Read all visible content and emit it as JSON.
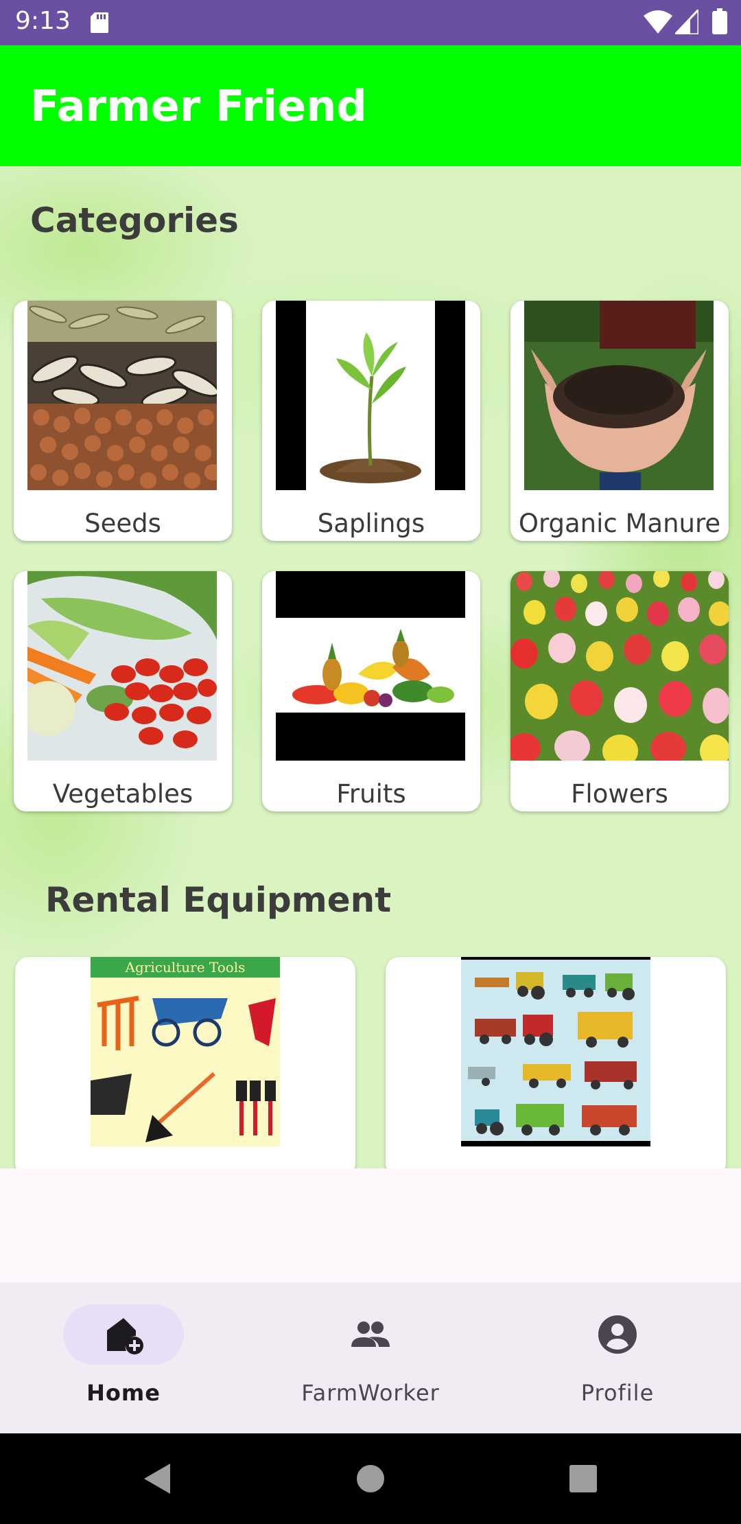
{
  "status_bar": {
    "time": "9:13"
  },
  "app_bar": {
    "title": "Farmer Friend"
  },
  "categories": {
    "title": "Categories",
    "items": [
      {
        "label": "Seeds"
      },
      {
        "label": "Saplings"
      },
      {
        "label": "Organic Manure"
      },
      {
        "label": "Vegetables"
      },
      {
        "label": "Fruits"
      },
      {
        "label": "Flowers"
      }
    ]
  },
  "rental": {
    "title": "Rental Equipment",
    "items": [
      {
        "image_caption": "Agriculture Tools"
      },
      {
        "image_caption": ""
      }
    ]
  },
  "bottom_nav": {
    "items": [
      {
        "label": "Home",
        "icon": "home-add-icon",
        "active": true
      },
      {
        "label": "FarmWorker",
        "icon": "people-icon",
        "active": false
      },
      {
        "label": "Profile",
        "icon": "account-circle-icon",
        "active": false
      }
    ]
  },
  "colors": {
    "status_bar": "#6a4fa2",
    "app_bar": "#00ff00",
    "nav_active_pill": "#e8def7",
    "nav_background": "#f1ebf4"
  }
}
